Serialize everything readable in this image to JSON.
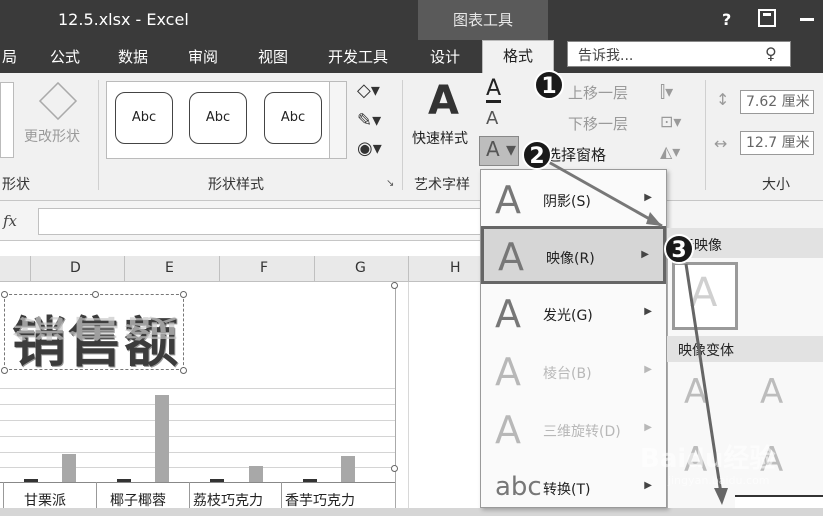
{
  "window": {
    "title": "12.5.xlsx - Excel",
    "context_tab": "图表工具",
    "help": "?",
    "restore_icon": "restore-icon",
    "minimize_icon": "minimize-icon"
  },
  "tabs": {
    "partial": "局",
    "formula": "公式",
    "data": "数据",
    "review": "审阅",
    "view": "视图",
    "developer": "开发工具",
    "design": "设计",
    "format": "格式"
  },
  "tellme": {
    "placeholder": "告诉我...",
    "icon": "lightbulb-icon"
  },
  "ribbon": {
    "change_shape": "更改形状",
    "group_shape": "形状",
    "shape_style_samples": [
      "Abc",
      "Abc",
      "Abc"
    ],
    "group_shape_styles": "形状样式",
    "quick_styles": "快速样式",
    "group_wordart": "艺术字样",
    "bring_forward": "上移一层",
    "send_backward": "下移一层",
    "selection_pane": "选择窗格",
    "height_value": "7.62 厘米",
    "width_value": "12.7 厘米",
    "group_size": "大小"
  },
  "formula_bar": {
    "fx": "fx",
    "value": ""
  },
  "sheet": {
    "columns": [
      "D",
      "E",
      "F",
      "G",
      "H"
    ],
    "chart_title": "销售额",
    "categories": [
      "甘栗派",
      "椰子椰蓉",
      "荔枝巧克力",
      "香芋巧克力"
    ]
  },
  "text_effects_menu": {
    "items": [
      {
        "icon": "A",
        "label": "阴影(S)",
        "enabled": true
      },
      {
        "icon": "A",
        "label": "映像(R)",
        "enabled": true,
        "highlighted": true
      },
      {
        "icon": "A",
        "label": "发光(G)",
        "enabled": true
      },
      {
        "icon": "A",
        "label": "棱台(B)",
        "enabled": false
      },
      {
        "icon": "A",
        "label": "三维旋转(D)",
        "enabled": false
      },
      {
        "icon": "abc",
        "label": "转换(T)",
        "enabled": true
      }
    ]
  },
  "reflection_submenu": {
    "header_no_reflection": "无映像",
    "header_variants": "映像变体"
  },
  "callouts": [
    "1",
    "2",
    "3"
  ],
  "watermark": "Baidu经验",
  "watermark_url": "jingyan.baidu.com"
}
